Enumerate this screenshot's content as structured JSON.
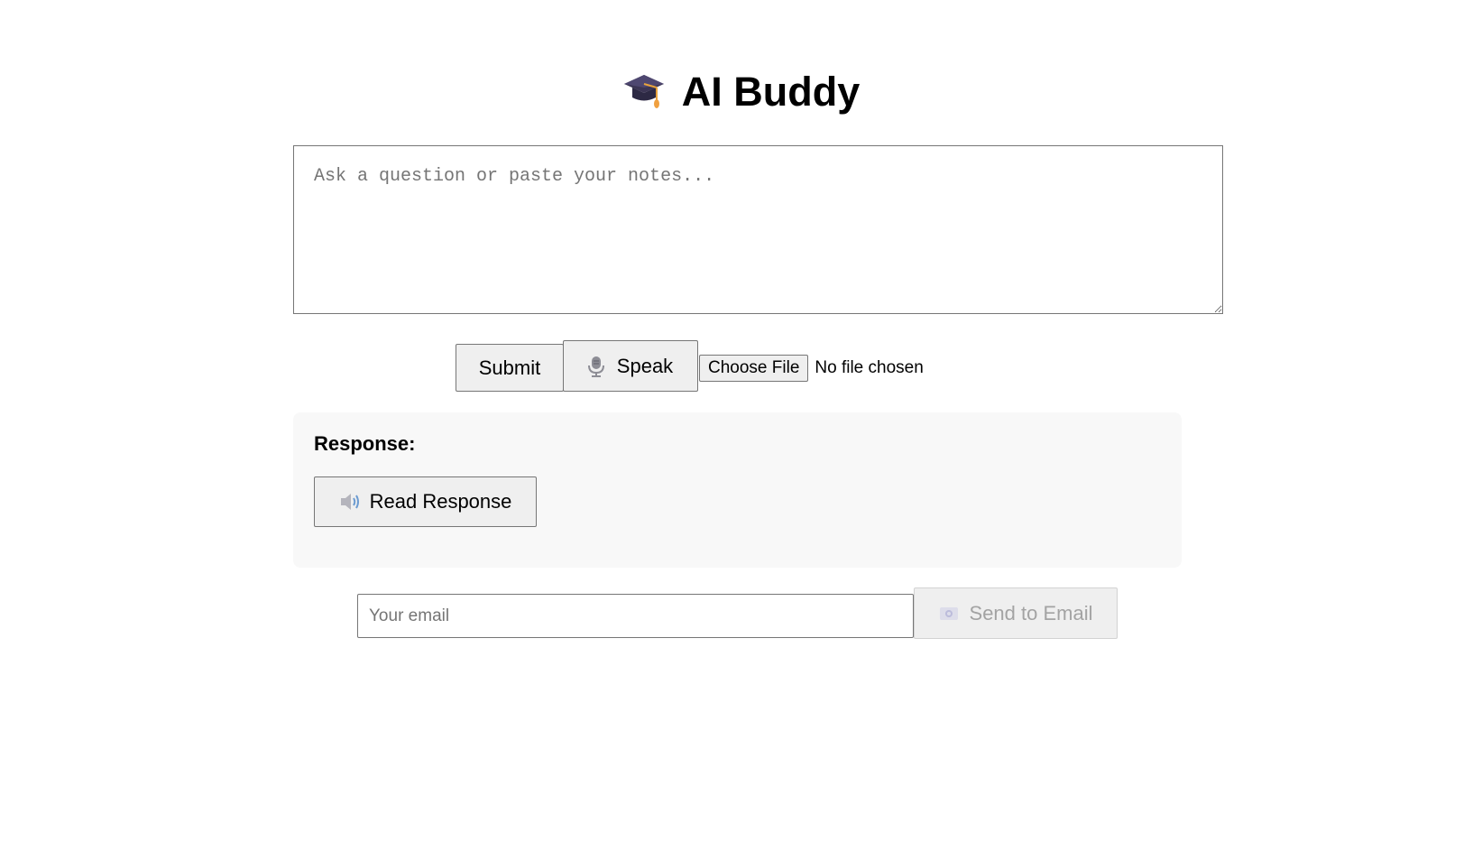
{
  "header": {
    "title": "AI Buddy",
    "icon": "graduation-cap-icon"
  },
  "prompt": {
    "placeholder": "Ask a question or paste your notes...",
    "value": ""
  },
  "actions": {
    "submit_label": "Submit",
    "speak_label": "Speak",
    "speak_icon": "microphone-icon",
    "file_button_label": "Choose File",
    "file_status": "No file chosen"
  },
  "response": {
    "heading": "Response:",
    "read_label": "Read Response",
    "read_icon": "speaker-icon"
  },
  "email": {
    "placeholder": "Your email",
    "value": "",
    "send_label": "Send to Email",
    "send_icon": "email-icon",
    "send_disabled": true
  }
}
